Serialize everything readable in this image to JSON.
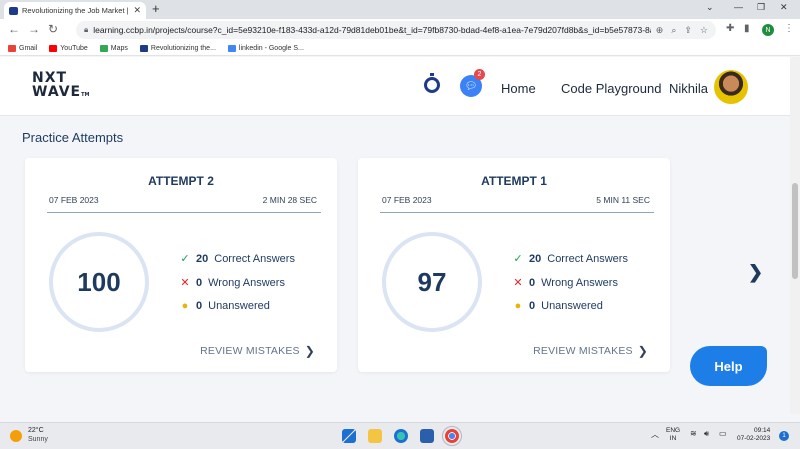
{
  "browser": {
    "tab_title": "Revolutionizing the Job Market |",
    "tab_close": "✕",
    "new_tab": "+",
    "url": "learning.ccbp.in/projects/course?c_id=5e93210e-f183-433d-a12d-79d81deb01be&t_id=79fb8730-bdad-4ef8-a1ea-7e79d207fd8b&s_id=b5e57873-8a0f...",
    "profile_initial": "N",
    "bookmarks": [
      "Gmail",
      "YouTube",
      "Maps",
      "Revolutionizing the...",
      "linkedin - Google S..."
    ],
    "bookmark_colors": [
      "#ea4335",
      "#ff0000",
      "#34a853",
      "#1e3a8a",
      "#4285f4"
    ]
  },
  "header": {
    "logo_line1": "NXT",
    "logo_line2": "WAVE",
    "logo_tm": "TM",
    "chat_badge": "2",
    "nav": {
      "home": "Home",
      "code_playground": "Code Playground"
    },
    "user_name": "Nikhila"
  },
  "main": {
    "section_title": "Practice Attempts",
    "cards": [
      {
        "title": "ATTEMPT 2",
        "date": "07 FEB 2023",
        "duration": "2 MIN 28 SEC",
        "score": "100",
        "correct_count": "20",
        "correct_label": "Correct Answers",
        "wrong_count": "0",
        "wrong_label": "Wrong Answers",
        "unanswered_count": "0",
        "unanswered_label": "Unanswered",
        "review_label": "REVIEW MISTAKES"
      },
      {
        "title": "ATTEMPT 1",
        "date": "07 FEB 2023",
        "duration": "5 MIN 11 SEC",
        "score": "97",
        "correct_count": "20",
        "correct_label": "Correct Answers",
        "wrong_count": "0",
        "wrong_label": "Wrong Answers",
        "unanswered_count": "0",
        "unanswered_label": "Unanswered",
        "review_label": "REVIEW MISTAKES"
      }
    ],
    "help_label": "Help"
  },
  "colors": {
    "accent": "#1d7ee8",
    "correct": "#16a34a",
    "wrong": "#dc2626",
    "unanswered": "#eab308",
    "primary_text": "#1e3a5f"
  },
  "taskbar": {
    "temperature": "22°C",
    "weather": "Sunny",
    "lang_line1": "ENG",
    "lang_line2": "IN",
    "time": "09:14",
    "date": "07-02-2023",
    "notification_count": "1"
  }
}
